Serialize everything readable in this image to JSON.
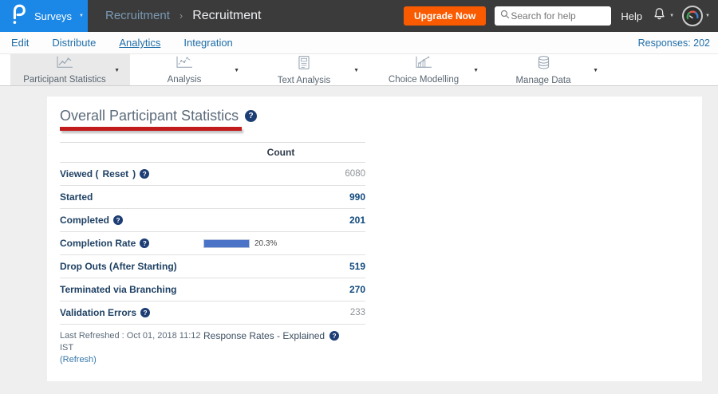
{
  "colors": {
    "header_bg": "#3b3b3b",
    "brand_blue": "#1b87e6",
    "upgrade_orange": "#fa5a00",
    "nav_link_blue": "#1e6da8",
    "table_navy": "#10497e",
    "bar_blue": "#4a72c7",
    "annotation_red": "#c11b1b",
    "help_icon_navy": "#1d3e75"
  },
  "glyphs": {
    "caret_down": "▼",
    "question": "?"
  },
  "header": {
    "product_menu_label": "Surveys",
    "breadcrumb": {
      "parent": "Recruitment",
      "separator": "›",
      "current": "Recruitment"
    },
    "upgrade_button_label": "Upgrade Now",
    "search_placeholder": "Search for help",
    "help_label": "Help"
  },
  "nav": {
    "items": [
      {
        "label": "Edit"
      },
      {
        "label": "Distribute"
      },
      {
        "label": "Analytics"
      },
      {
        "label": "Integration"
      }
    ],
    "responses_label": "Responses: 202"
  },
  "toolbar": {
    "tabs": [
      {
        "label": "Participant Statistics",
        "icon": "line-chart-icon",
        "selected": true
      },
      {
        "label": "Analysis",
        "icon": "trend-chart-icon",
        "selected": false
      },
      {
        "label": "Text Analysis",
        "icon": "document-icon",
        "selected": false
      },
      {
        "label": "Choice Modelling",
        "icon": "bar-trend-icon",
        "selected": false
      },
      {
        "label": "Manage Data",
        "icon": "database-icon",
        "selected": false
      }
    ]
  },
  "content": {
    "title": "Overall Participant Statistics",
    "table": {
      "count_header": "Count",
      "rows": [
        {
          "label_prefix": "Viewed ( ",
          "reset_link": "Reset",
          "label_suffix": " )",
          "help": true,
          "value": "6080",
          "emphasis": false
        },
        {
          "label": "Started",
          "help": false,
          "value": "990",
          "emphasis": true
        },
        {
          "label": "Completed",
          "help": true,
          "value": "201",
          "emphasis": true
        },
        {
          "label": "Completion Rate",
          "help": true,
          "bar_percent": 20.3,
          "bar_label": "20.3%"
        },
        {
          "label": "Drop Outs (After Starting)",
          "help": false,
          "value": "519",
          "emphasis": true
        },
        {
          "label": "Terminated via Branching",
          "help": false,
          "value": "270",
          "emphasis": true
        },
        {
          "label": "Validation Errors",
          "help": true,
          "value": "233",
          "emphasis": false
        }
      ]
    },
    "footer": {
      "last_refreshed": "Last Refreshed : Oct 01, 2018 11:12 IST",
      "refresh_link": "(Refresh)",
      "explained_link": "Response Rates - Explained"
    }
  }
}
